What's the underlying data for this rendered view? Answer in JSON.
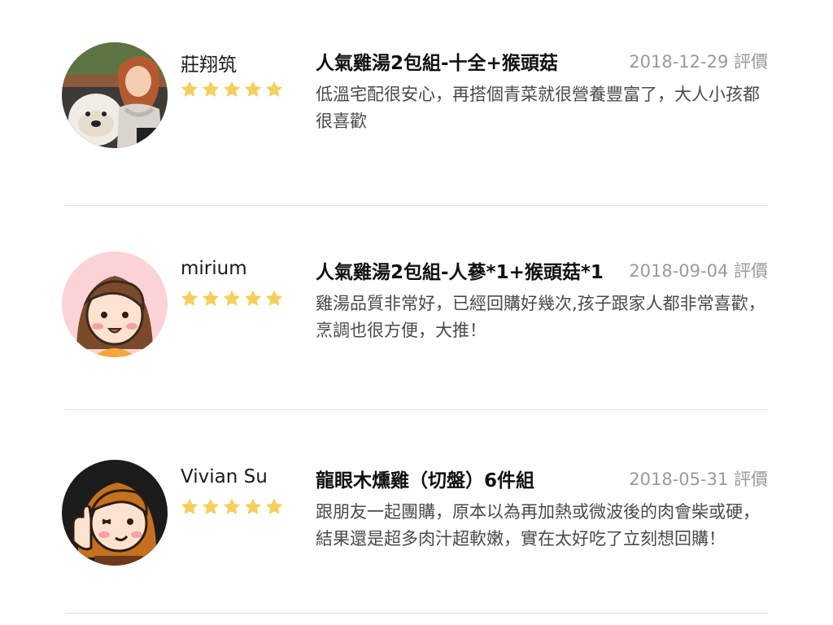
{
  "reviews": [
    {
      "name": "莊翔筑",
      "rating": 5,
      "product": "人氣雞湯2包組-十全+猴頭菇",
      "date": "2018-12-29 評價",
      "comment": "低溫宅配很安心，再搭個青菜就很營養豐富了，大人小孩都很喜歡",
      "avatar_icon": "photo-avatar-woman-with-dog"
    },
    {
      "name": "mirium",
      "rating": 5,
      "product": "人氣雞湯2包組-人蔘*1+猴頭菇*1",
      "date": "2018-09-04 評價",
      "comment": "雞湯品質非常好，已經回購好幾次,孩子跟家人都非常喜歡，烹調也很方便，大推！",
      "avatar_icon": "cartoon-girl-avatar"
    },
    {
      "name": "Vivian Su",
      "rating": 5,
      "product": "龍眼木燻雞（切盤）6件組",
      "date": "2018-05-31 評價",
      "comment": "跟朋友一起團購，原本以為再加熱或微波後的肉會柴或硬，結果還是超多肉汁超軟嫩，實在太好吃了立刻想回購！",
      "avatar_icon": "cartoon-thumbs-up-avatar"
    }
  ],
  "colors": {
    "star": "#f5cf5c",
    "date": "#9a9a9a",
    "comment": "#4a4a4a",
    "divider": "#dedede"
  }
}
